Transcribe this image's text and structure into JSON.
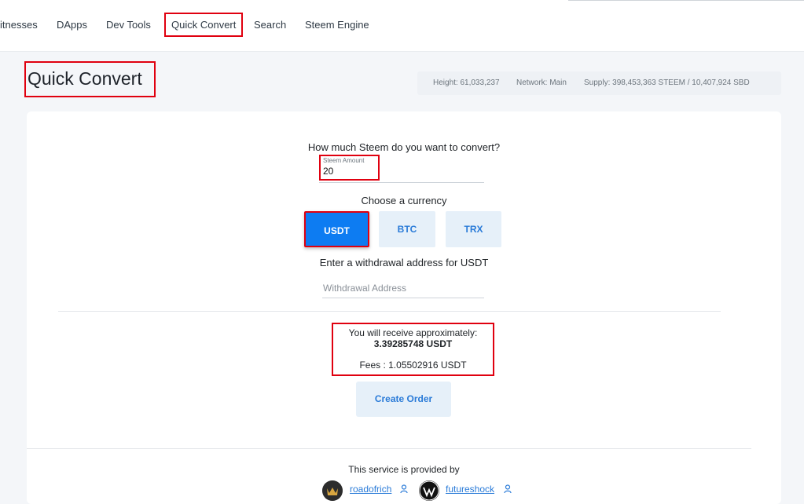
{
  "nav": {
    "items": [
      {
        "label": "itnesses"
      },
      {
        "label": "DApps"
      },
      {
        "label": "Dev Tools"
      },
      {
        "label": "Quick Convert"
      },
      {
        "label": "Search"
      },
      {
        "label": "Steem Engine"
      }
    ]
  },
  "page": {
    "title": "Quick Convert"
  },
  "network_info": {
    "height": "Height: 61,033,237",
    "network": "Network: Main",
    "supply": "Supply: 398,453,363 STEEM / 10,407,924 SBD"
  },
  "form": {
    "amount_prompt": "How much Steem do you want to convert?",
    "amount_label": "Steem Amount",
    "amount_value": "20",
    "currency_prompt": "Choose a currency",
    "currencies": [
      {
        "label": "USDT",
        "selected": true
      },
      {
        "label": "BTC",
        "selected": false
      },
      {
        "label": "TRX",
        "selected": false
      }
    ],
    "address_prompt": "Enter a withdrawal address for USDT",
    "address_placeholder": "Withdrawal Address"
  },
  "result": {
    "receive_label": "You will receive approximately:",
    "receive_amount": "3.39285748 USDT",
    "fees": "Fees : 1.05502916 USDT"
  },
  "actions": {
    "create_order": "Create Order"
  },
  "footer": {
    "provided_by": "This service is provided by",
    "providers": [
      {
        "name": "roadofrich",
        "icon": "user-icon"
      },
      {
        "name": "futureshock",
        "icon": "user-icon"
      }
    ]
  },
  "colors": {
    "highlight": "#e0000f",
    "primary": "#0d7cf2",
    "link": "#2a7bd8"
  }
}
